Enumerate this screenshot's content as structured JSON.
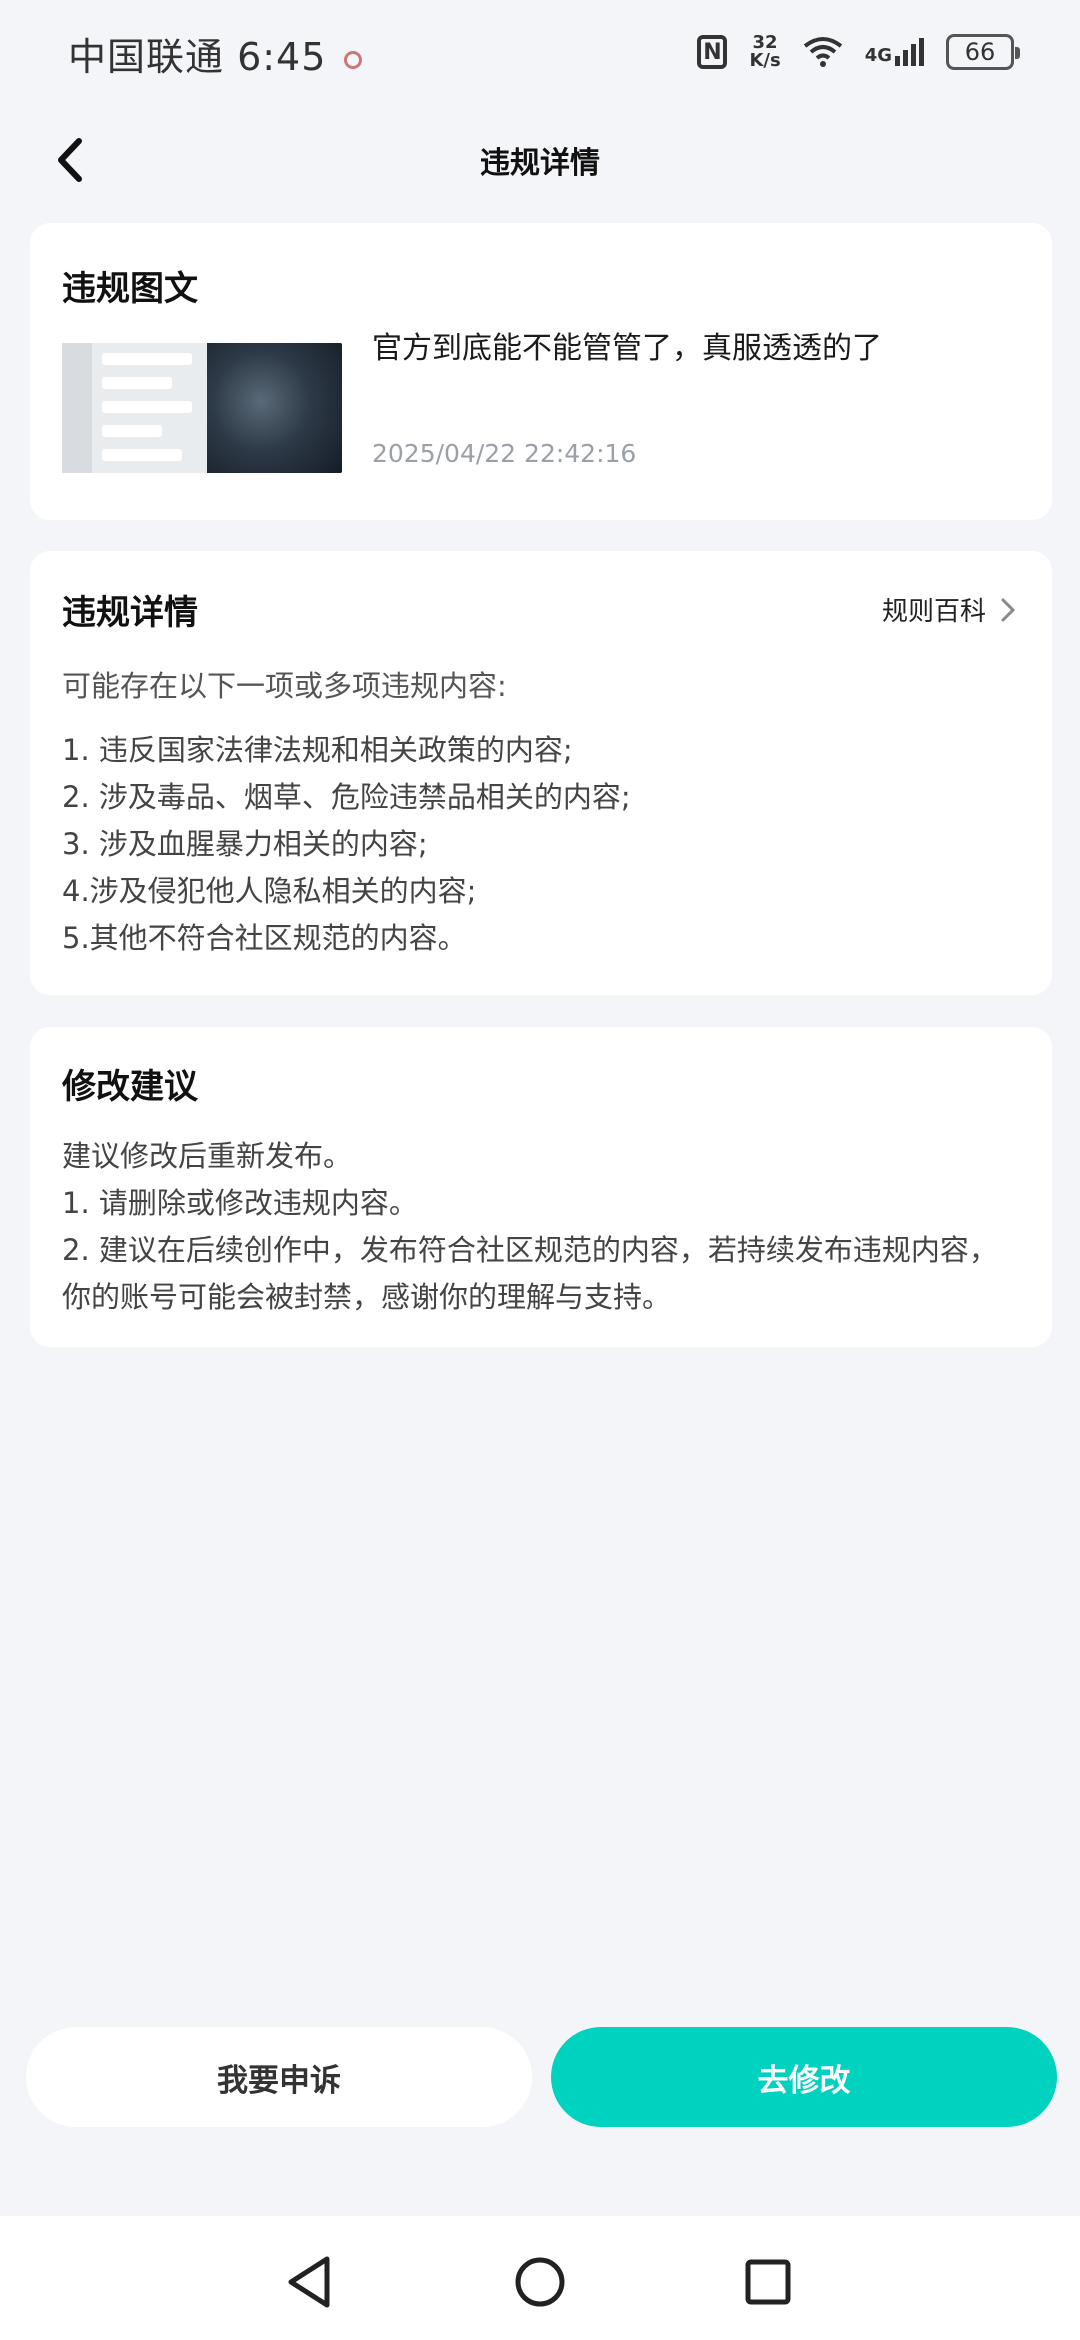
{
  "status_bar": {
    "carrier_time": "中国联通 6:45",
    "net_speed_value": "32",
    "net_speed_unit": "K/s",
    "network_type": "4G",
    "battery": "66"
  },
  "header": {
    "title": "违规详情"
  },
  "post_card": {
    "title": "违规图文",
    "post_text": "官方到底能不能管管了，真服透透的了",
    "timestamp": "2025/04/22 22:42:16"
  },
  "details_card": {
    "title": "违规详情",
    "rules_link": "规则百科",
    "intro": "可能存在以下一项或多项违规内容:",
    "items": [
      "1. 违反国家法律法规和相关政策的内容;",
      "2. 涉及毒品、烟草、危险违禁品相关的内容;",
      "3. 涉及血腥暴力相关的内容;",
      "4.涉及侵犯他人隐私相关的内容;",
      "5.其他不符合社区规范的内容。"
    ]
  },
  "advice_card": {
    "title": "修改建议",
    "lines": [
      "建议修改后重新发布。",
      "1. 请删除或修改违规内容。",
      "2. 建议在后续创作中，发布符合社区规范的内容，若持续发布违规内容，你的账号可能会被封禁，感谢你的理解与支持。"
    ]
  },
  "actions": {
    "appeal_label": "我要申诉",
    "modify_label": "去修改"
  },
  "colors": {
    "accent": "#00d2c0",
    "background": "#f4f5f9"
  }
}
